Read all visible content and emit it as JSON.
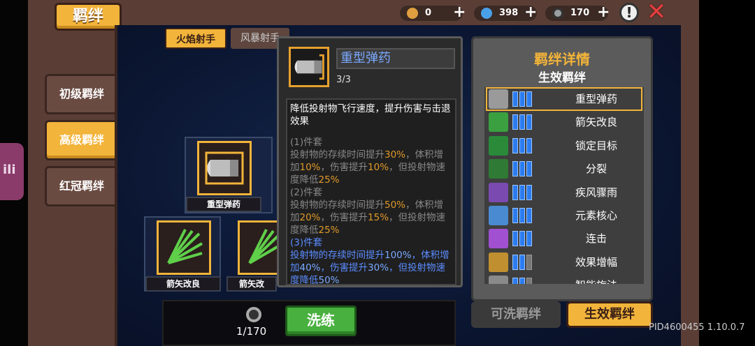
{
  "title": "羁绊",
  "resources": [
    {
      "name": "gold-icon",
      "value": "0",
      "color": "#e0a040"
    },
    {
      "name": "gem-icon",
      "value": "398",
      "color": "#4aa0e8"
    },
    {
      "name": "gear-token-icon",
      "value": "170",
      "color": "#9aa0a0"
    }
  ],
  "side_tabs": [
    "初级羁绊",
    "高级羁绊",
    "红冠羁绊"
  ],
  "active_side_tab": "高级羁绊",
  "top_tabs": [
    "火焰射手",
    "风暴射手"
  ],
  "nodes": [
    {
      "label": "重型弹药"
    },
    {
      "label": "箭矢改良"
    },
    {
      "label": "箭矢改"
    }
  ],
  "tooltip": {
    "name": "重型弹药",
    "count": "3/3",
    "description": "降低投射物飞行速度，提升伤害与击退效果",
    "tiers": [
      {
        "header": "(1)件套",
        "parts": [
          "投射物的存续时间提升",
          "30%",
          "，体积增加",
          "10%",
          "，伤害提升",
          "10%",
          "，但投射物速度降低",
          "25%"
        ]
      },
      {
        "header": "(2)件套",
        "parts": [
          "投射物的存续时间提升",
          "50%",
          "，体积增加",
          "20%",
          "，伤害提升",
          "15%",
          "，但投射物速度降低",
          "25%"
        ]
      },
      {
        "header": "(3)件套",
        "parts": [
          "投射物的存续时间提升",
          "100%",
          "，体积增加",
          "40%",
          "，伤害提升",
          "30%",
          "，但投射物速度降低",
          "50%"
        ]
      }
    ]
  },
  "panel": {
    "title": "羁绊详情",
    "subtitle": "生效羁绊",
    "bonds": [
      {
        "name": "重型弹药",
        "icon": "bullet-icon",
        "color": "#9a9a9a",
        "level": 3
      },
      {
        "name": "箭矢改良",
        "icon": "arrow-burst-icon",
        "color": "#3aa040",
        "level": 3
      },
      {
        "name": "锁定目标",
        "icon": "target-icon",
        "color": "#2a8a3a",
        "level": 3
      },
      {
        "name": "分裂",
        "icon": "split-arrow-icon",
        "color": "#2f7a34",
        "level": 3
      },
      {
        "name": "疾风骤雨",
        "icon": "tornado-icon",
        "color": "#7a4ab0",
        "level": 3
      },
      {
        "name": "元素核心",
        "icon": "element-core-icon",
        "color": "#4a8ad0",
        "level": 3
      },
      {
        "name": "连击",
        "icon": "combo-crystal-icon",
        "color": "#a050d0",
        "level": 3
      },
      {
        "name": "效果增幅",
        "icon": "amplify-icon",
        "color": "#c09030",
        "level": 2
      },
      {
        "name": "智能旋法",
        "icon": "smart-icon",
        "color": "#8a8a8a",
        "level": 2
      }
    ]
  },
  "reroll_cost": "1/170",
  "wash_label": "洗练",
  "bottom_tabs": {
    "reroll": "可洗羁绊",
    "effective": "生效羁绊"
  },
  "pid": "PID4600455 1.10.0.7"
}
